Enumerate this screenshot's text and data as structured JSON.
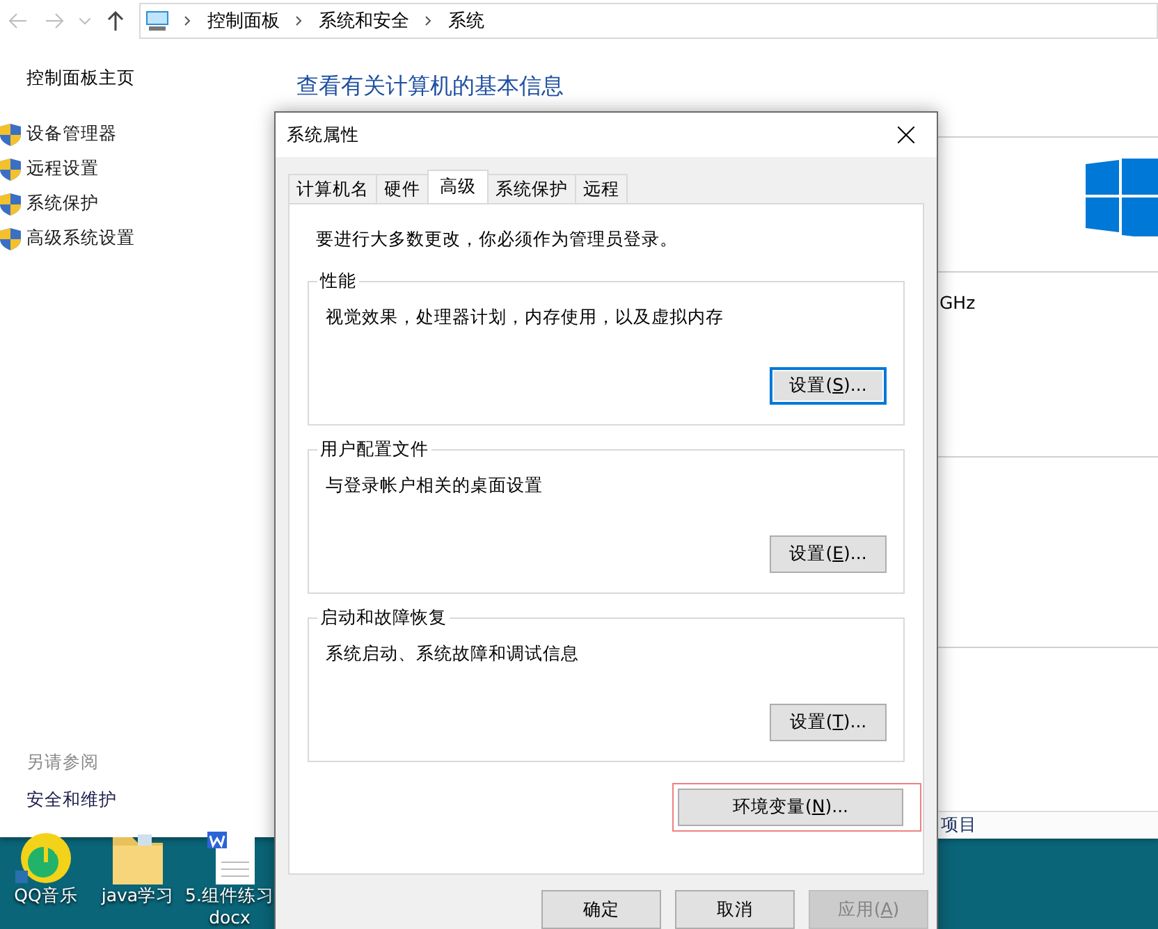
{
  "explorer": {
    "breadcrumb": [
      "控制面板",
      "系统和安全",
      "系统"
    ],
    "sidebar": {
      "home": "控制面板主页",
      "items": [
        "设备管理器",
        "远程设置",
        "系统保护",
        "高级系统设置"
      ],
      "see_also": "另请参阅",
      "links": [
        "安全和维护"
      ]
    },
    "heading": "查看有关计算机的基本信息",
    "cpu_fragment": "GHz",
    "bottom_fragment": "项目"
  },
  "desktop_icons": [
    {
      "kind": "music",
      "label": "QQ音乐"
    },
    {
      "kind": "folder",
      "label": "java学习"
    },
    {
      "kind": "doc",
      "label": "5.组件练习\ndocx"
    }
  ],
  "dialog": {
    "title": "系统属性",
    "tabs": [
      {
        "label": "计算机名",
        "selected": false
      },
      {
        "label": "硬件",
        "selected": false
      },
      {
        "label": "高级",
        "selected": true
      },
      {
        "label": "系统保护",
        "selected": false
      },
      {
        "label": "远程",
        "selected": false
      }
    ],
    "notice": "要进行大多数更改，你必须作为管理员登录。",
    "groups": [
      {
        "title": "性能",
        "text": "视觉效果，处理器计划，内存使用，以及虚拟内存",
        "button": {
          "before": "设置(",
          "key": "S",
          "after": ")...",
          "focused": true
        }
      },
      {
        "title": "用户配置文件",
        "text": "与登录帐户相关的桌面设置",
        "button": {
          "before": "设置(",
          "key": "E",
          "after": ")...",
          "focused": false
        }
      },
      {
        "title": "启动和故障恢复",
        "text": "系统启动、系统故障和调试信息",
        "button": {
          "before": "设置(",
          "key": "T",
          "after": ")...",
          "focused": false
        }
      }
    ],
    "env_button": {
      "before": "环境变量(",
      "key": "N",
      "after": ")...",
      "highlighted": true
    },
    "footer": [
      {
        "label": "确定",
        "disabled": false
      },
      {
        "label": "取消",
        "disabled": false
      },
      {
        "before": "应用(",
        "key": "A",
        "after": ")",
        "disabled": true
      }
    ]
  }
}
